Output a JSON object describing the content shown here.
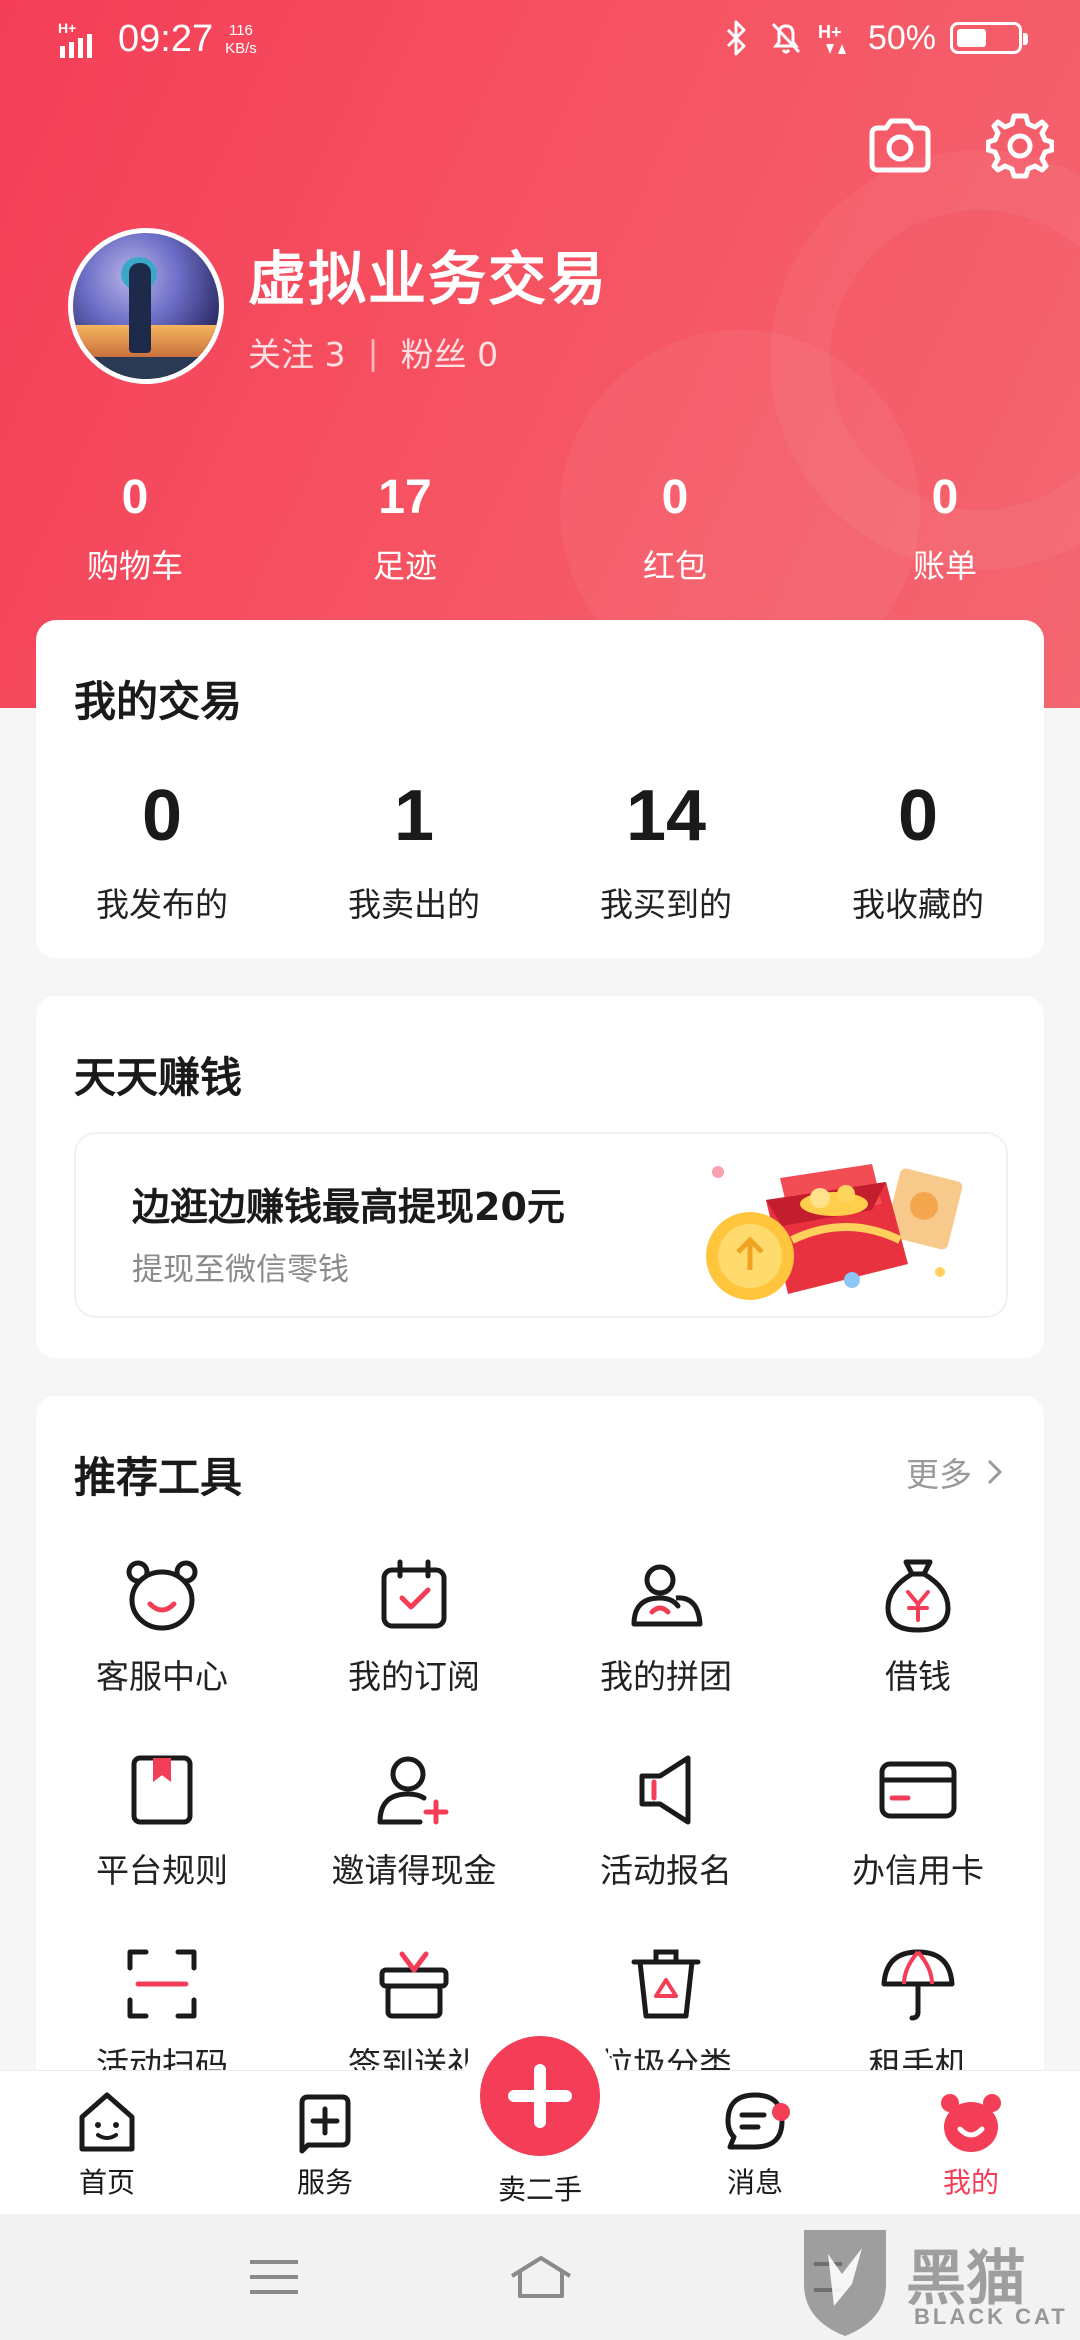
{
  "status_bar": {
    "network": "H+",
    "time": "09:27",
    "speed_value": "116",
    "speed_unit": "KB/s",
    "second_network": "H+",
    "battery_text": "50%",
    "battery_level": 0.5
  },
  "header": {
    "username": "虚拟业务交易",
    "follow_label": "关注 3",
    "fans_label": "粉丝 0",
    "separator": "|",
    "icons": [
      "camera-icon",
      "gear-icon"
    ]
  },
  "stats": [
    {
      "value": "0",
      "label": "购物车"
    },
    {
      "value": "17",
      "label": "足迹"
    },
    {
      "value": "0",
      "label": "红包"
    },
    {
      "value": "0",
      "label": "账单"
    }
  ],
  "my_trades": {
    "title": "我的交易",
    "items": [
      {
        "value": "0",
        "label": "我发布的"
      },
      {
        "value": "1",
        "label": "我卖出的"
      },
      {
        "value": "14",
        "label": "我买到的"
      },
      {
        "value": "0",
        "label": "我收藏的"
      }
    ]
  },
  "earn": {
    "title": "天天赚钱",
    "banner_title": "边逛边赚钱最高提现20元",
    "banner_sub": "提现至微信零钱"
  },
  "tools": {
    "title": "推荐工具",
    "more": "更多",
    "items": [
      {
        "label": "客服中心",
        "icon": "bear-face-icon"
      },
      {
        "label": "我的订阅",
        "icon": "calendar-check-icon"
      },
      {
        "label": "我的拼团",
        "icon": "group-icon"
      },
      {
        "label": "借钱",
        "icon": "money-bag-icon"
      },
      {
        "label": "平台规则",
        "icon": "rulebook-icon"
      },
      {
        "label": "邀请得现金",
        "icon": "invite-user-icon"
      },
      {
        "label": "活动报名",
        "icon": "megaphone-icon"
      },
      {
        "label": "办信用卡",
        "icon": "credit-card-icon"
      },
      {
        "label": "活动扫码",
        "icon": "scan-icon"
      },
      {
        "label": "签到送礼",
        "icon": "gift-box-icon"
      },
      {
        "label": "垃圾分类",
        "icon": "recycle-bin-icon"
      },
      {
        "label": "租手机",
        "icon": "umbrella-icon"
      }
    ]
  },
  "tab_bar": {
    "tabs": [
      {
        "label": "首页",
        "icon": "home-face-icon"
      },
      {
        "label": "服务",
        "icon": "service-plus-icon"
      },
      {
        "label": "卖二手",
        "icon": "plus-icon"
      },
      {
        "label": "消息",
        "icon": "message-icon"
      },
      {
        "label": "我的",
        "icon": "bear-profile-icon"
      }
    ],
    "active": "我的",
    "accent": "#f43e57"
  },
  "watermark": {
    "text": "黑猫",
    "sub": "BLACK CAT"
  },
  "colors": {
    "header_red": "#f43e57",
    "page_bg": "#f6f6f6"
  }
}
